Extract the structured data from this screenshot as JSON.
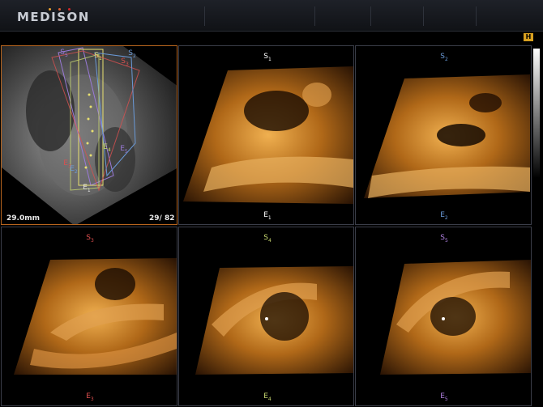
{
  "header": {
    "logo_text": "MEDISON",
    "dot_colors": [
      "#e8a030",
      "#e06030",
      "#d02828"
    ]
  },
  "side": {
    "badge": "H"
  },
  "ref_panel": {
    "depth": "29.0mm",
    "frame": "29/ 82",
    "slice_labels": [
      {
        "text": "S",
        "sub": "5",
        "color": "#9a7ad8"
      },
      {
        "text": "S",
        "sub": "1",
        "color": "#e8e070"
      },
      {
        "text": "S",
        "sub": "3",
        "color": "#d85050"
      },
      {
        "text": "S",
        "sub": "2",
        "color": "#6a9ad8"
      },
      {
        "text": "E",
        "sub": "4",
        "color": "#c8d870"
      },
      {
        "text": "E",
        "sub": "5",
        "color": "#9a7ad8"
      },
      {
        "text": "E",
        "sub": "3",
        "color": "#d85050"
      },
      {
        "text": "E",
        "sub": "2",
        "color": "#6a9ad8"
      },
      {
        "text": "E",
        "sub": "1",
        "color": "#e8e8e8"
      }
    ]
  },
  "panels": [
    {
      "top": "S",
      "top_sub": "1",
      "bottom": "E",
      "bottom_sub": "1",
      "color": "#ffffff"
    },
    {
      "top": "S",
      "top_sub": "2",
      "bottom": "E",
      "bottom_sub": "2",
      "color": "#6a9ad8"
    },
    {
      "top": "S",
      "top_sub": "3",
      "bottom": "E",
      "bottom_sub": "3",
      "color": "#e05050"
    },
    {
      "top": "S",
      "top_sub": "4",
      "bottom": "E",
      "bottom_sub": "4",
      "color": "#c8d870"
    },
    {
      "top": "S",
      "top_sub": "5",
      "bottom": "E",
      "bottom_sub": "5",
      "color": "#b080e0"
    }
  ]
}
